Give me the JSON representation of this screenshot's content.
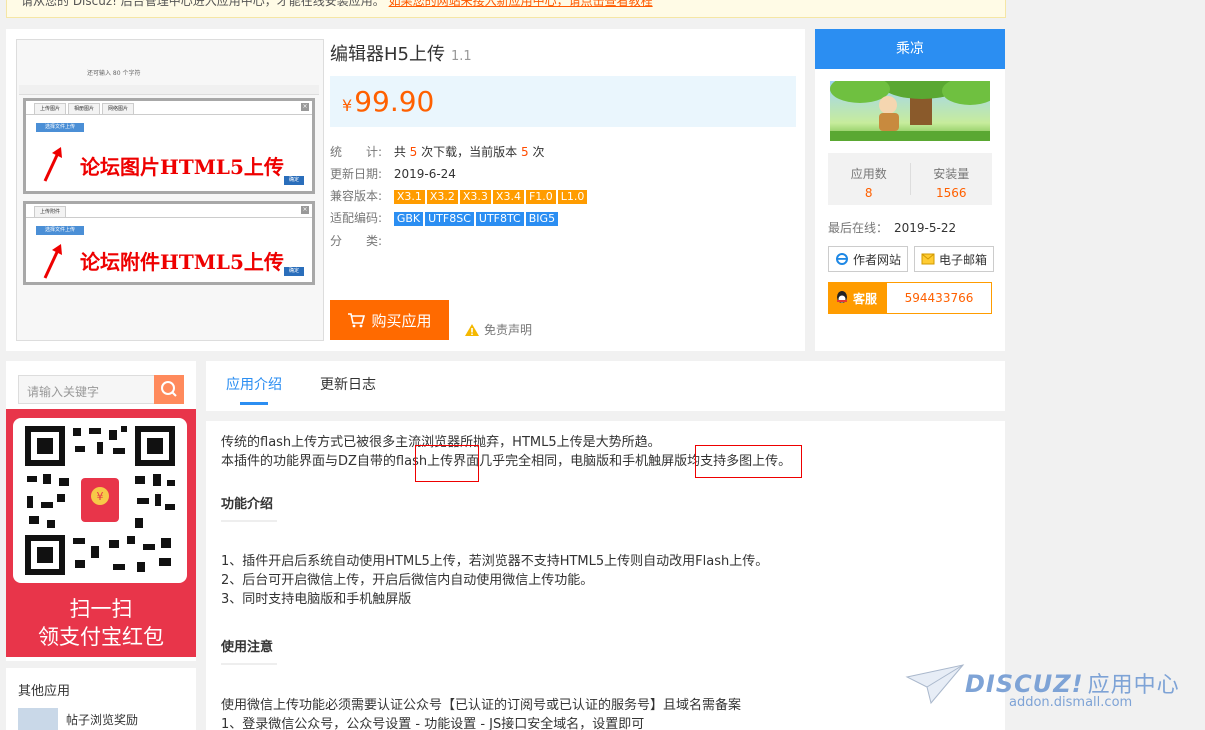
{
  "notice": {
    "text": "请从您的 Discuz! 后台管理中心进入应用中心，才能在线安装应用。",
    "link": "如果您的网站未接入新应用中心，请点击查看教程"
  },
  "screenshot": {
    "hint_text": "还可输入 80 个字符",
    "dialog1": {
      "tabs": [
        "上传图片",
        "相册图片",
        "网络图片"
      ],
      "pick_label": "选择文件上传",
      "ok": "确定",
      "caption": "论坛图片HTML5上传"
    },
    "dialog2": {
      "tabs": [
        "上传附件"
      ],
      "pick_label": "选择文件上传",
      "ok": "确定",
      "caption": "论坛附件HTML5上传"
    }
  },
  "app": {
    "title": "编辑器H5上传",
    "version": "1.1",
    "price": "99.90",
    "currency": "¥",
    "stats_label": "统　　计:",
    "stats_pre": "共",
    "downloads": "5",
    "stats_mid": "次下载，当前版本",
    "version_downloads": "5",
    "stats_post": "次",
    "updated_label": "更新日期:",
    "updated": "2019-6-24",
    "compat_label": "兼容版本:",
    "compat": [
      "X3.1",
      "X3.2",
      "X3.3",
      "X3.4",
      "F1.0",
      "L1.0"
    ],
    "encoding_label": "适配编码:",
    "encodings": [
      "GBK",
      "UTF8SC",
      "UTF8TC",
      "BIG5"
    ],
    "category_label": "分　　类:",
    "buy_label": "购买应用",
    "disclaimer": "免责声明"
  },
  "author": {
    "name": "乘凉",
    "apps_label": "应用数",
    "apps": "8",
    "installs_label": "安装量",
    "installs": "1566",
    "last_online_label": "最后在线：",
    "last_online": "2019-5-22",
    "website_label": "作者网站",
    "email_label": "电子邮箱",
    "service_label": "客服",
    "service_qq": "594433766"
  },
  "search": {
    "placeholder": "请输入关键字"
  },
  "promo": {
    "line1": "扫一扫",
    "line2": "领支付宝红包"
  },
  "other": {
    "title": "其他应用",
    "item1": "帖子浏览奖励"
  },
  "tabs": [
    "应用介绍",
    "更新日志"
  ],
  "content": {
    "p1": "传统的flash上传方式已被很多主流浏览器所抛弃，HTML5上传是大势所趋。",
    "p2": "本插件的功能界面与DZ自带的flash上传界面几乎完全相同，电脑版和手机触屏版均支持多图上传。",
    "h1": "功能介绍",
    "l1": "1、插件开启后系统自动使用HTML5上传，若浏览器不支持HTML5上传则自动改用Flash上传。",
    "l2": "2、后台可开启微信上传，开启后微信内自动使用微信上传功能。",
    "l3": "3、同时支持电脑版和手机触屏版",
    "h2": "使用注意",
    "n1": "使用微信上传功能必须需要认证公众号【已认证的订阅号或已认证的服务号】且域名需备案",
    "n2": "1、登录微信公众号，公众号设置 - 功能设置 - JS接口安全域名，设置即可"
  },
  "watermark": {
    "brand": "DISCUZ!",
    "suffix": "应用中心",
    "url": "addon.dismall.com"
  },
  "colors": {
    "accent": "#2b8ef2",
    "price": "#ff6000",
    "buy": "#ff6a00",
    "tag_orange": "#ff9c00",
    "promo_red": "#e8354a"
  }
}
